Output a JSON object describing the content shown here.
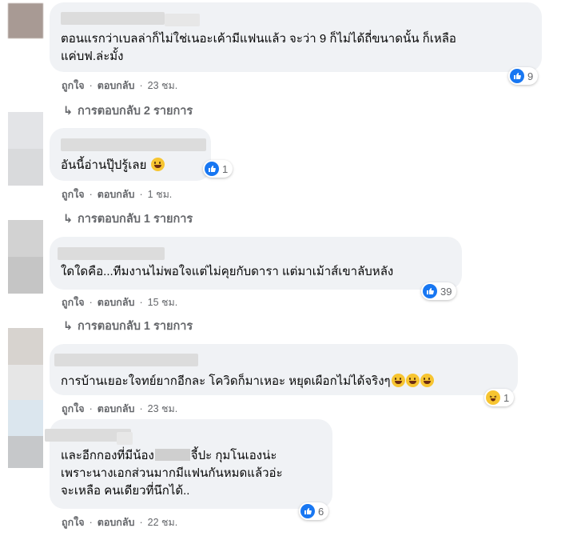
{
  "colors": {
    "bubble": "#f0f2f5",
    "meta_text": "#65676b",
    "like_blue": "#1877f2",
    "haha_yellow": "#f7c531"
  },
  "comments": [
    {
      "lines": [
        "ตอนแรกว่าเบลล่าก็ไม่ใช่เนอะเค้ามีแฟนแล้ว จะว่า 9 ก็ไม่ได้ถี่ขนาดนั้น ก็เหลือ",
        "แค่บฟ.ล่ะมั้ง"
      ],
      "like": "ถูกใจ",
      "reply": "ตอบกลับ",
      "time": "23 ชม.",
      "reaction_icon": "like-icon",
      "reaction_count": "9",
      "replies_label": "การตอบกลับ 2 รายการ"
    },
    {
      "lines": [
        "อันนี้อ่านปุ๊ปรู้เลย"
      ],
      "like": "ถูกใจ",
      "reply": "ตอบกลับ",
      "time": "1 ชม.",
      "reaction_icon": "like-icon",
      "reaction_count": "1",
      "replies_label": "การตอบกลับ 1 รายการ"
    },
    {
      "lines": [
        "ใดใดคือ...ทีมงานไม่พอใจแต่ไม่คุยกับดารา แต่มาเม้าส์เขาลับหลัง"
      ],
      "like": "ถูกใจ",
      "reply": "ตอบกลับ",
      "time": "15 ชม.",
      "reaction_icon": "like-icon",
      "reaction_count": "39",
      "replies_label": "การตอบกลับ 1 รายการ"
    },
    {
      "lines": [
        "การบ้านเยอะใจทย์ยากอีกละ โควิดก็มาเหอะ หยุดเผือกไม่ได้จริงๆ"
      ],
      "like": "ถูกใจ",
      "reply": "ตอบกลับ",
      "time": "23 ชม.",
      "reaction_icon": "haha-icon",
      "reaction_count": "1"
    },
    {
      "line1_a": "และอีกกองที่มีน้อง",
      "line1_b": "จี้ปะ กุมโนเองน่ะ",
      "lines": [
        "เพราะนางเอกส่วนมากมีแฟนกันหมดแล้วอ่ะ",
        "จะเหลือ คนเดียวที่นึกได้.."
      ],
      "like": "ถูกใจ",
      "reply": "ตอบกลับ",
      "time": "22 ชม.",
      "reaction_icon": "like-icon",
      "reaction_count": "6"
    }
  ]
}
